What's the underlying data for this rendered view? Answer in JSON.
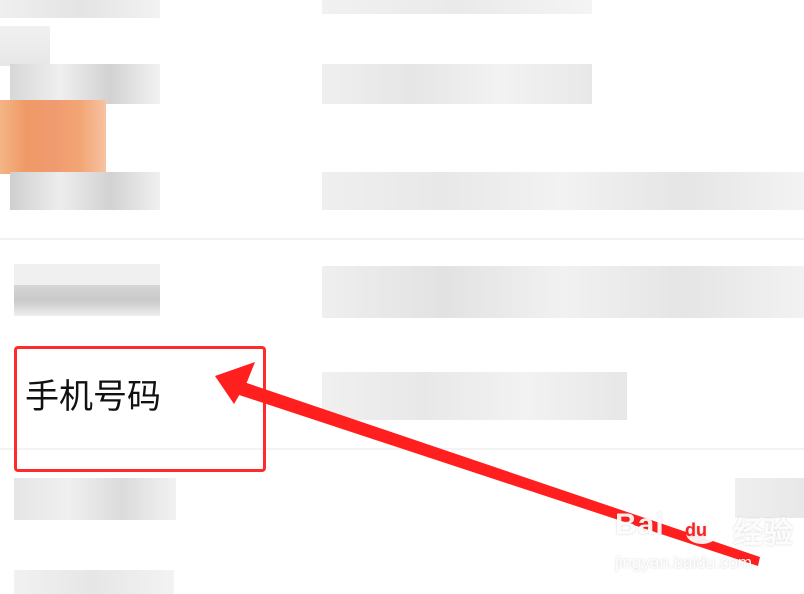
{
  "field": {
    "label": "手机号码"
  },
  "watermark": {
    "brand": "Bai",
    "paw": "du",
    "cn": "经验",
    "url": "jingyan.baidu.com"
  },
  "colors": {
    "highlight": "#ff2b2b",
    "arrow": "#ff1f1f",
    "mosaic_gray_light": "#ececec",
    "mosaic_gray_mid": "#d8d8d8",
    "mosaic_gray_dark": "#b4b4b4",
    "mosaic_orange": "#f2a574"
  },
  "icons": {
    "arrow": "annotation-arrow-icon",
    "paw": "baidu-paw-icon"
  }
}
